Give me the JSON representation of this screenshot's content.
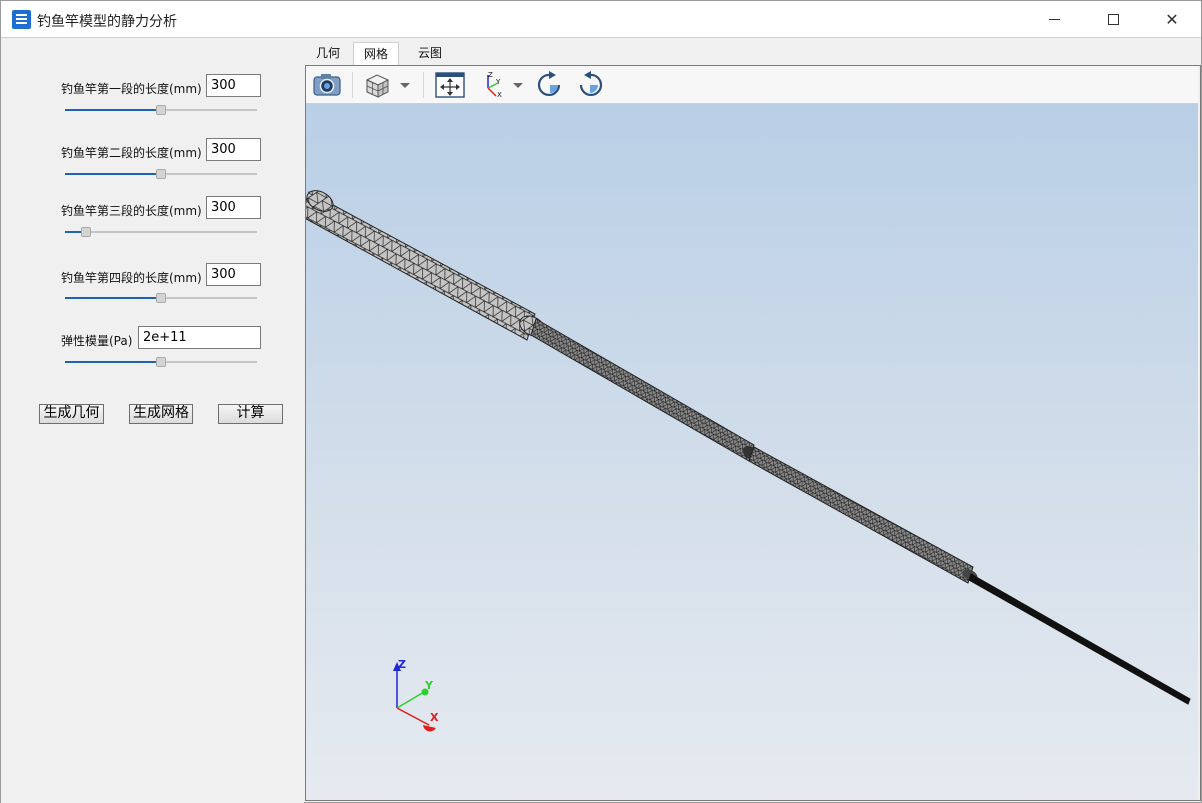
{
  "window": {
    "title": "钓鱼竿模型的静力分析"
  },
  "params": [
    {
      "label": "钓鱼竿第一段的长度(mm)",
      "value": "300",
      "slider_fraction": 0.5
    },
    {
      "label": "钓鱼竿第二段的长度(mm)",
      "value": "300",
      "slider_fraction": 0.5
    },
    {
      "label": "钓鱼竿第三段的长度(mm)",
      "value": "300",
      "slider_fraction": 0.11
    },
    {
      "label": "钓鱼竿第四段的长度(mm)",
      "value": "300",
      "slider_fraction": 0.5
    },
    {
      "label": "弹性模量(Pa)",
      "value": "2e+11",
      "slider_fraction": 0.5
    }
  ],
  "buttons": {
    "generate_geometry": "生成几何",
    "generate_mesh": "生成网格",
    "compute": "计算"
  },
  "tabs": [
    {
      "label": "几何",
      "active": false
    },
    {
      "label": "网格",
      "active": true
    },
    {
      "label": "云图",
      "active": false
    }
  ],
  "toolbar": [
    "camera-icon",
    "view-cube-icon",
    "dropdown-arrow-icon",
    "fit-all-icon",
    "axes-orientation-icon",
    "dropdown-arrow-icon",
    "rotate-cw-icon",
    "rotate-ccw-icon"
  ],
  "axes_triad": {
    "z": "Z",
    "y": "Y",
    "x": "X",
    "colors": {
      "z": "#1c27d6",
      "y": "#2bd22b",
      "x": "#e01c1c"
    }
  },
  "colors": {
    "accent": "#1a63b8",
    "mesh_fill": "#b8b8b8",
    "mesh_line": "#202020"
  }
}
